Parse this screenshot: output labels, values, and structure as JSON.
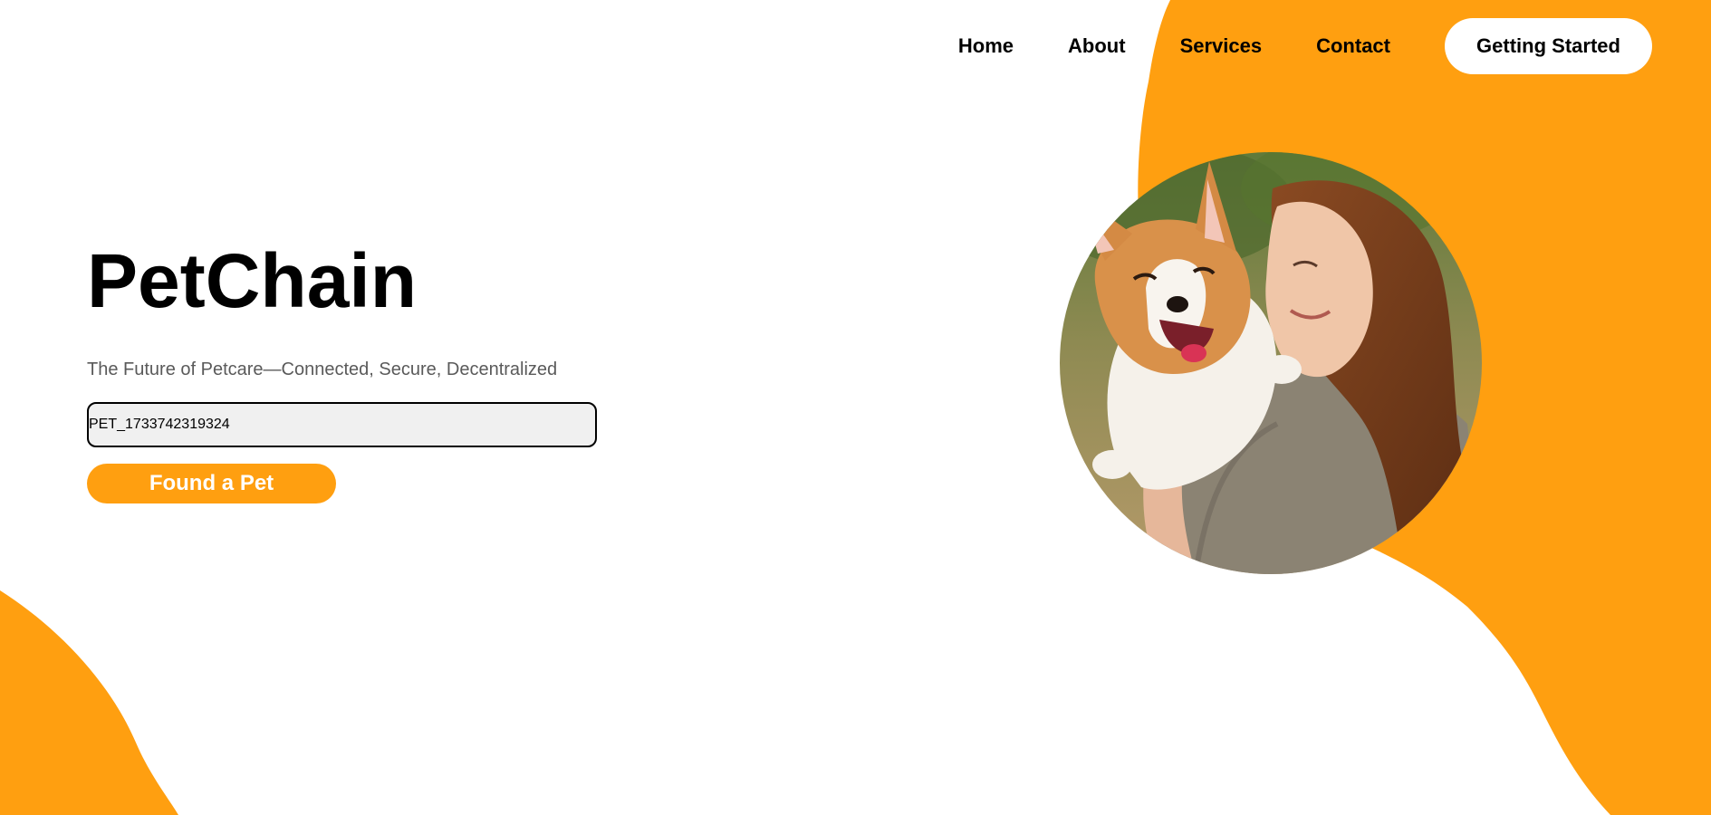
{
  "colors": {
    "accent": "#ff9f10",
    "background": "#ffffff",
    "input_bg": "#f0f0f0",
    "text": "#000000",
    "subtitle": "#5a5a5a"
  },
  "nav": {
    "items": [
      {
        "label": "Home"
      },
      {
        "label": "About"
      },
      {
        "label": "Services"
      },
      {
        "label": "Contact"
      }
    ],
    "cta_label": "Getting Started"
  },
  "hero": {
    "title": "PetChain",
    "subtitle": "The Future of Petcare—Connected, Secure, Decentralized",
    "pet_id_value": "PET_1733742319324",
    "button_label": "Found a Pet"
  },
  "photo": {
    "subject": "woman-holding-corgi-photo"
  }
}
